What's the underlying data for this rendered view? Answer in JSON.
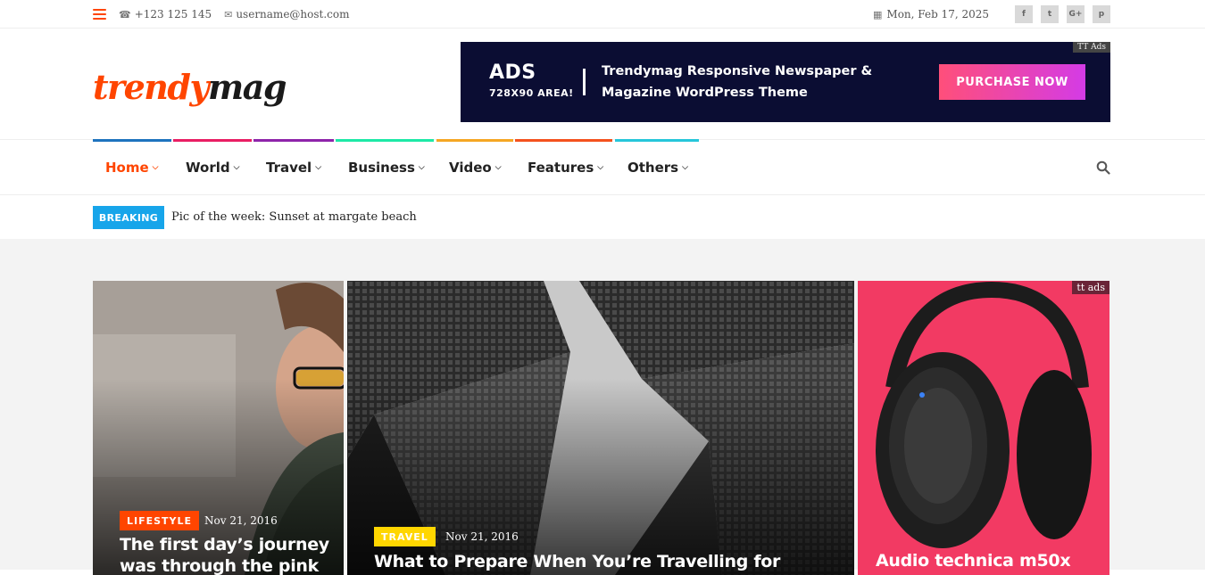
{
  "topbar": {
    "phone": "+123 125 145",
    "email": "username@host.com",
    "date": "Mon, Feb 17, 2025",
    "social": [
      {
        "icon": "facebook-icon",
        "glyph": "f"
      },
      {
        "icon": "twitter-icon",
        "glyph": "t"
      },
      {
        "icon": "google-plus-icon",
        "glyph": "G+"
      },
      {
        "icon": "pinterest-icon",
        "glyph": "p"
      }
    ]
  },
  "logo": {
    "part1": "trendy",
    "part2": "mag"
  },
  "banner": {
    "tag": "TT Ads",
    "ads": "ADS",
    "ads_sub": "728X90 AREA!",
    "description": "Trendymag Responsive Newspaper & Magazine WordPress Theme",
    "cta": "PURCHASE NOW"
  },
  "nav": {
    "items": [
      {
        "label": "Home",
        "color": "#1e73be",
        "active": true
      },
      {
        "label": "World",
        "color": "#e91e63"
      },
      {
        "label": "Travel",
        "color": "#8e24aa"
      },
      {
        "label": "Business",
        "color": "#1de9a6"
      },
      {
        "label": "Video",
        "color": "#f5a623"
      },
      {
        "label": "Features",
        "color": "#f4511e"
      },
      {
        "label": "Others",
        "color": "#26c6da"
      }
    ]
  },
  "breaking": {
    "label": "BREAKING",
    "text": "Pic of the week: Sunset at margate beach"
  },
  "cards": [
    {
      "category": "LIFESTYLE",
      "category_color": "#ff4500",
      "date": "Nov 21, 2016",
      "title": "The first day’s journey was through the pink fields"
    },
    {
      "category": "TRAVEL",
      "category_color": "#ffd600",
      "date": "Nov 21, 2016",
      "title": "What to Prepare When You’re Travelling for Holiday"
    },
    {
      "ad_tag": "tt ads",
      "title": "Audio technica m50x"
    }
  ]
}
